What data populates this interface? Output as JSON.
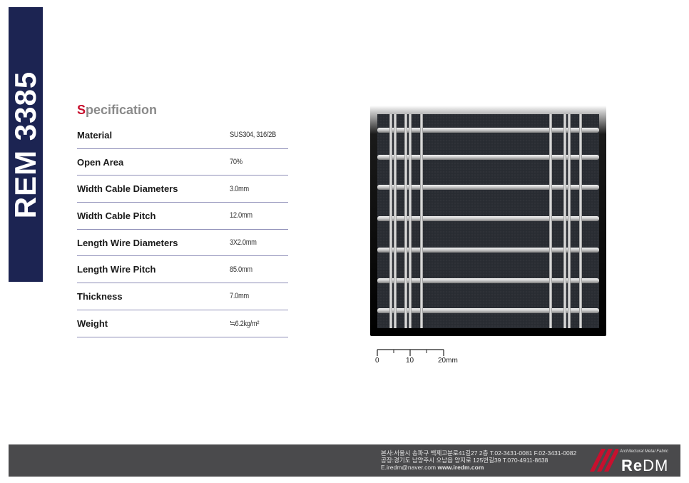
{
  "product_code": "REM 3385",
  "spec": {
    "title_first": "S",
    "title_rest": "pecification",
    "rows": [
      {
        "label": "Material",
        "value": "SUS304, 316/2B"
      },
      {
        "label": "Open Area",
        "value": "70%"
      },
      {
        "label": "Width Cable Diameters",
        "value": "3.0mm"
      },
      {
        "label": "Width Cable Pitch",
        "value": "12.0mm"
      },
      {
        "label": "Length Wire Diameters",
        "value": "3X2.0mm"
      },
      {
        "label": "Length Wire Pitch",
        "value": "85.0mm"
      },
      {
        "label": "Thickness",
        "value": "7.0mm"
      },
      {
        "label": "Weight",
        "value": "≒6.2kg/m²"
      }
    ]
  },
  "scale_bar": {
    "labels": [
      "0",
      "10",
      "20mm"
    ]
  },
  "footer": {
    "line1": "본사:서울시 송파구 백제고분로41길27 2층 T.02-3431-0081 F.02-3431-0082",
    "line2": "공장:경기도 남양주시 오남읍 양지로 125번길39 T.070-4911-8638",
    "email": "E.iredm@naver.com",
    "website": "www.iredm.com"
  },
  "logo": {
    "tagline": "Architectural Metal Fabric",
    "word_re": "Re",
    "word_dm": "DM",
    "color_red": "#c8102e"
  },
  "colors": {
    "side_tab": "#1c2452",
    "accent_red": "#c8102e",
    "row_divider": "#8f8fb8",
    "footer_bg": "#4a4a4c"
  }
}
